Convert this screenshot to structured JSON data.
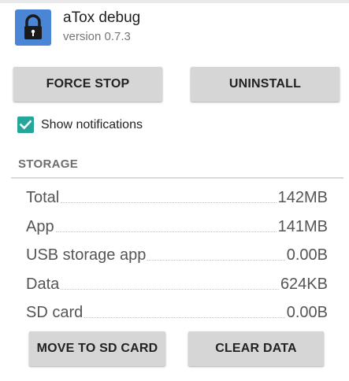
{
  "app": {
    "name": "aTox debug",
    "version": "version 0.7.3",
    "icon": "lock-icon",
    "icon_color": "#4b86d6"
  },
  "actions": {
    "force_stop": "FORCE STOP",
    "uninstall": "UNINSTALL"
  },
  "notifications": {
    "label": "Show notifications",
    "checked": true,
    "accent": "#26a69a"
  },
  "storage": {
    "header": "STORAGE",
    "rows": [
      {
        "label": "Total",
        "value": "142MB"
      },
      {
        "label": "App",
        "value": "141MB"
      },
      {
        "label": "USB storage app",
        "value": "0.00B"
      },
      {
        "label": "Data",
        "value": "624KB"
      },
      {
        "label": "SD card",
        "value": "0.00B"
      }
    ],
    "move_to_sd": "MOVE TO SD CARD",
    "clear_data": "CLEAR DATA"
  }
}
